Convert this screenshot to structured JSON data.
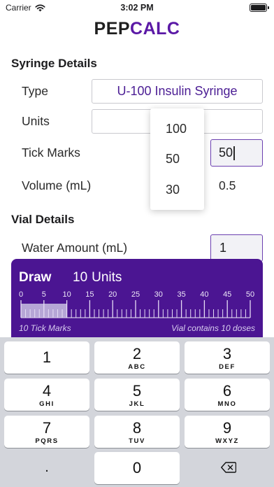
{
  "status_bar": {
    "carrier": "Carrier",
    "time": "3:02 PM",
    "battery_level": 1.0
  },
  "logo": {
    "part1": "PEP",
    "part2": "CALC"
  },
  "syringe": {
    "title": "Syringe Details",
    "type_label": "Type",
    "type_value": "U-100 Insulin Syringe",
    "units_label": "Units",
    "units_value": "",
    "tick_label": "Tick Marks",
    "tick_value": "50",
    "volume_label": "Volume (mL)",
    "volume_value": "0.5"
  },
  "units_dropdown": {
    "options": [
      "100",
      "50",
      "30"
    ]
  },
  "vial": {
    "title": "Vial Details",
    "water_label": "Water Amount (mL)",
    "water_value": "1"
  },
  "draw": {
    "title": "Draw",
    "amount": "10",
    "unit": "Units",
    "ruler_labels": [
      "0",
      "5",
      "10",
      "15",
      "20",
      "25",
      "30",
      "35",
      "40",
      "45",
      "50"
    ],
    "ruler_max": 50,
    "ruler_fill": 10,
    "tick_caption": "10 Tick Marks",
    "vial_caption": "Vial contains 10 doses"
  },
  "keypad": {
    "keys": [
      {
        "num": "1",
        "letters": ""
      },
      {
        "num": "2",
        "letters": "ABC"
      },
      {
        "num": "3",
        "letters": "DEF"
      },
      {
        "num": "4",
        "letters": "GHI"
      },
      {
        "num": "5",
        "letters": "JKL"
      },
      {
        "num": "6",
        "letters": "MNO"
      },
      {
        "num": "7",
        "letters": "PQRS"
      },
      {
        "num": "8",
        "letters": "TUV"
      },
      {
        "num": "9",
        "letters": "WXYZ"
      },
      {
        "num": ".",
        "letters": ""
      },
      {
        "num": "0",
        "letters": ""
      }
    ]
  },
  "colors": {
    "brand_purple": "#5b19a6",
    "panel_purple": "#4b1592",
    "accent_border": "#6b3fb0"
  }
}
